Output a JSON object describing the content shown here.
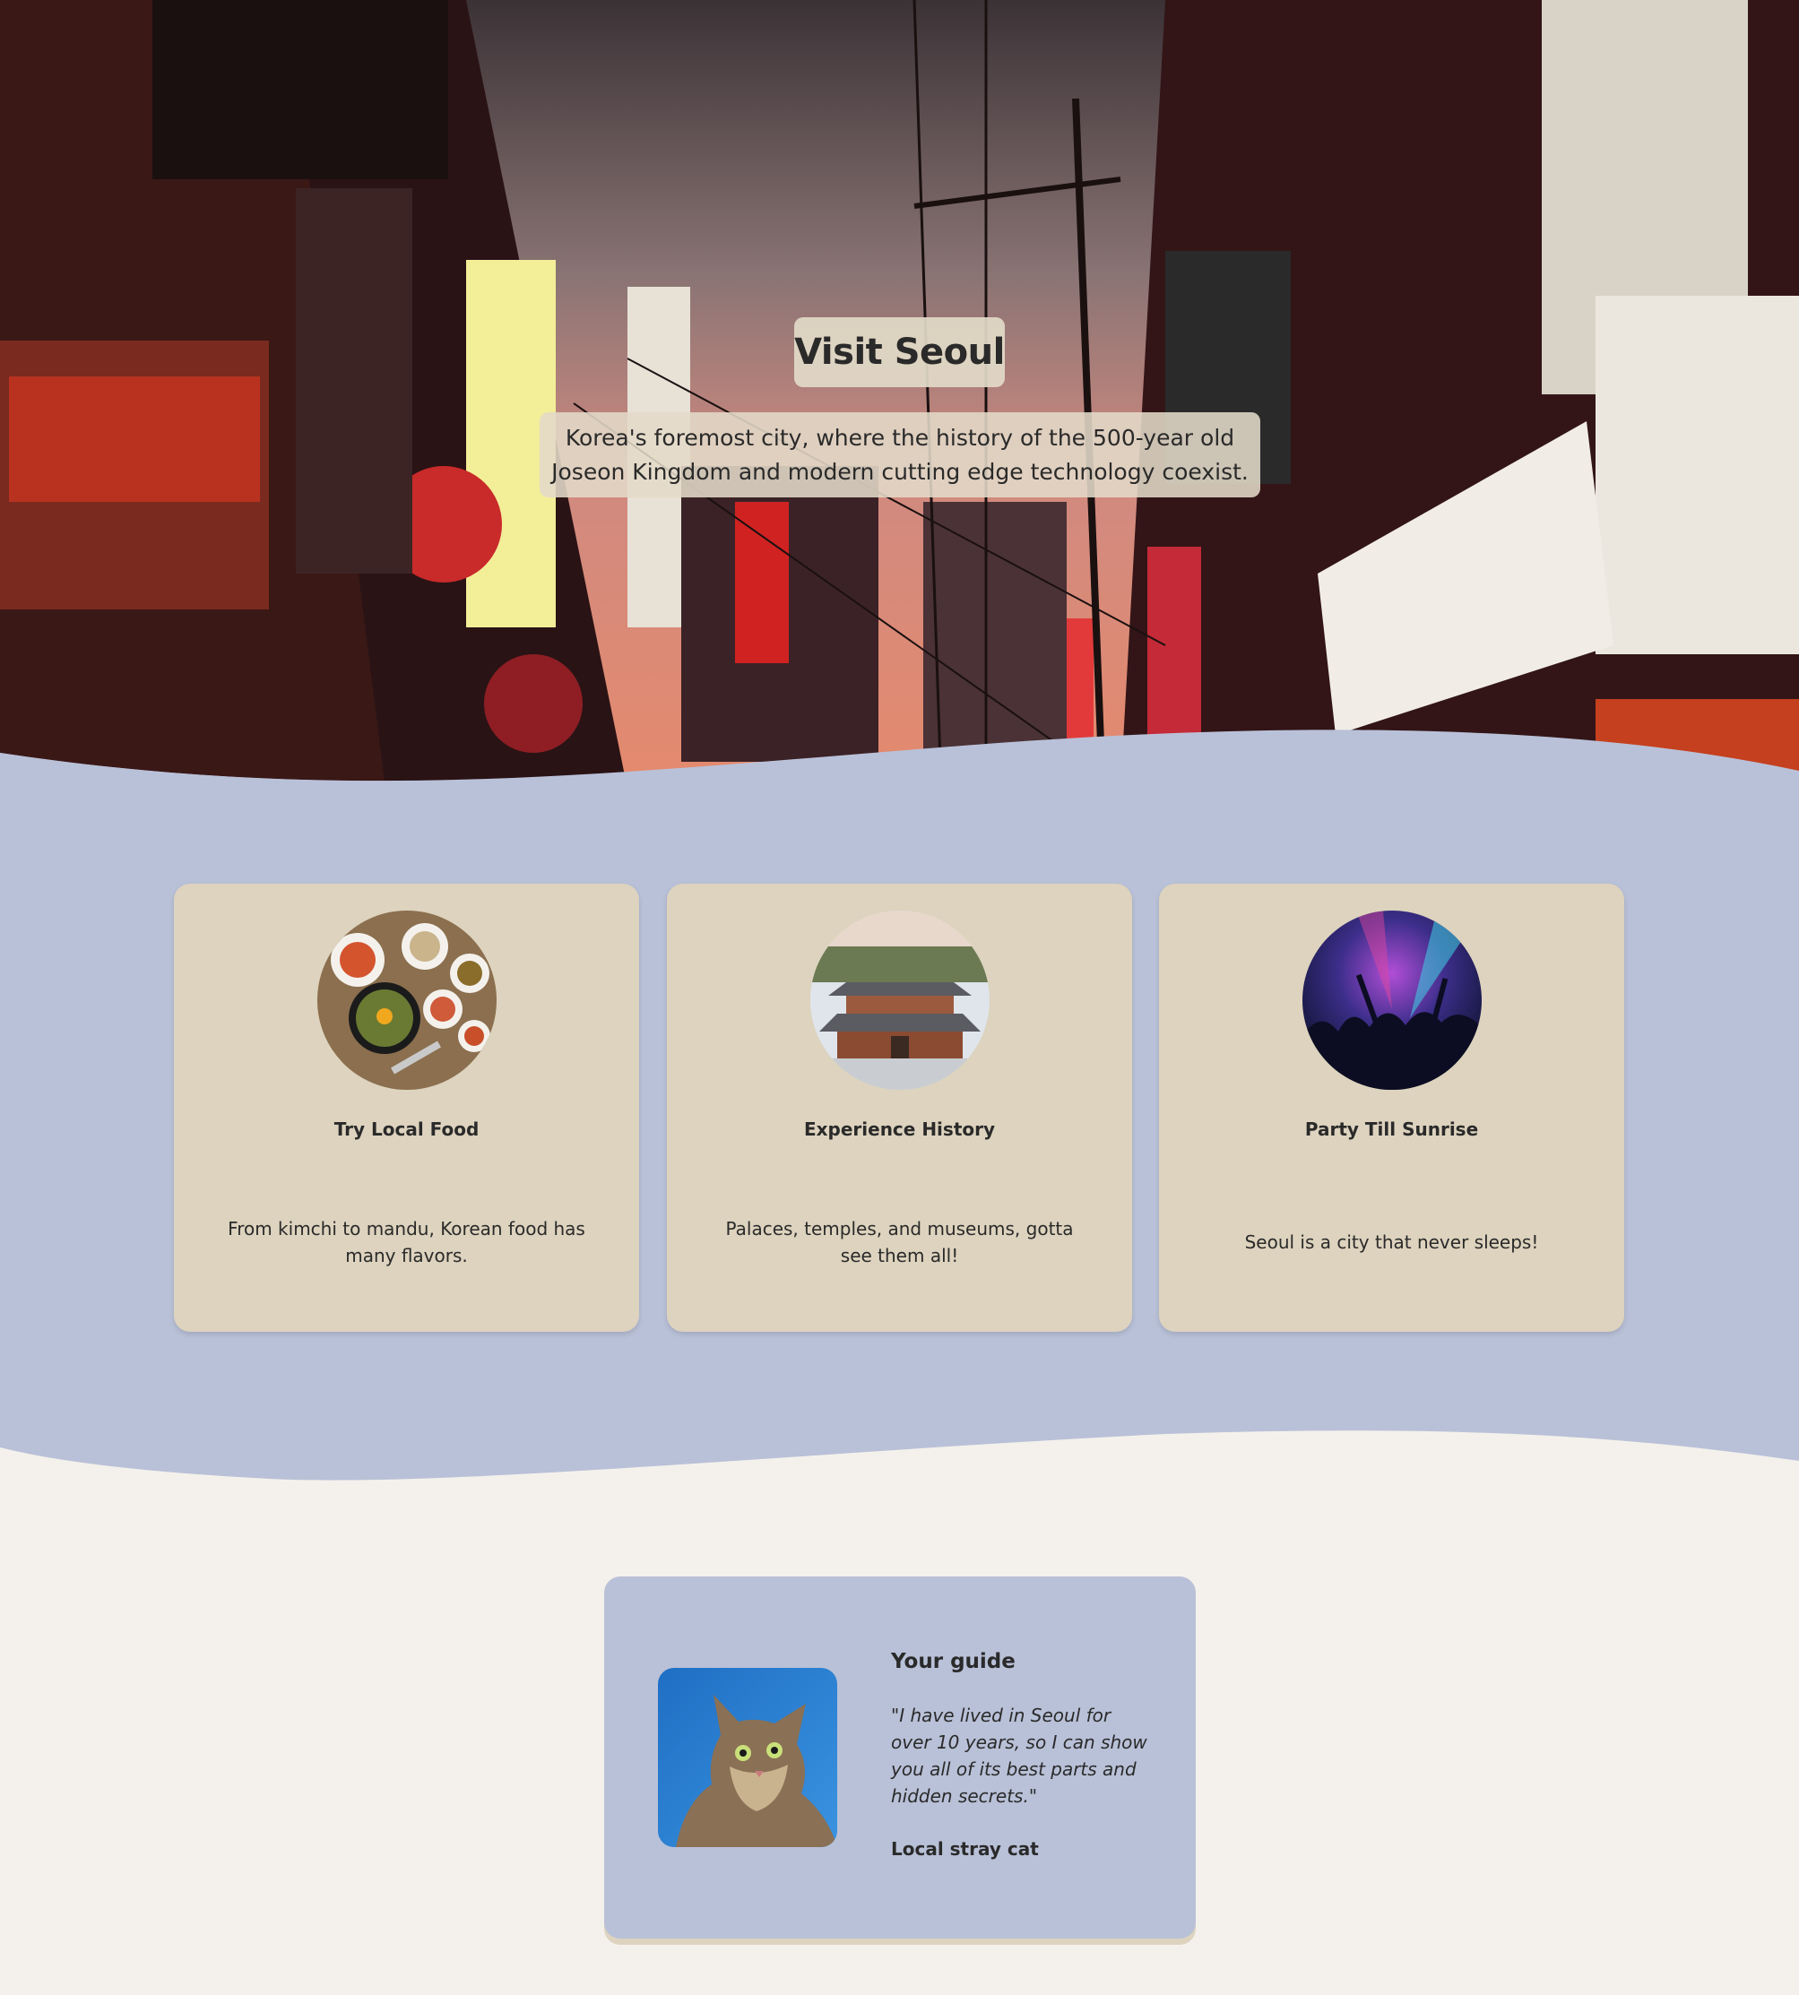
{
  "hero": {
    "title": "Visit Seoul",
    "subtitle": "Korea's foremost city, where the history of the 500-year old Joseon Kingdom and modern cutting edge technology coexist."
  },
  "cards": [
    {
      "title": "Try Local Food",
      "text": "From kimchi to mandu, Korean food has many flavors.",
      "image": "korean-food-photo"
    },
    {
      "title": "Experience History",
      "text": "Palaces, temples, and museums, gotta see them all!",
      "image": "palace-photo"
    },
    {
      "title": "Party Till Sunrise",
      "text": "Seoul is a city that never sleeps!",
      "image": "concert-crowd-photo"
    }
  ],
  "guide": {
    "heading": "Your guide",
    "quote": "\"I have lived in Seoul for over 10 years, so I can show you all of its best parts and hidden secrets.\"",
    "author": "Local stray cat",
    "image": "cat-photo"
  },
  "colors": {
    "band": "#b9c1d8",
    "card": "#ddd3be",
    "page": "#f4f1ec"
  }
}
